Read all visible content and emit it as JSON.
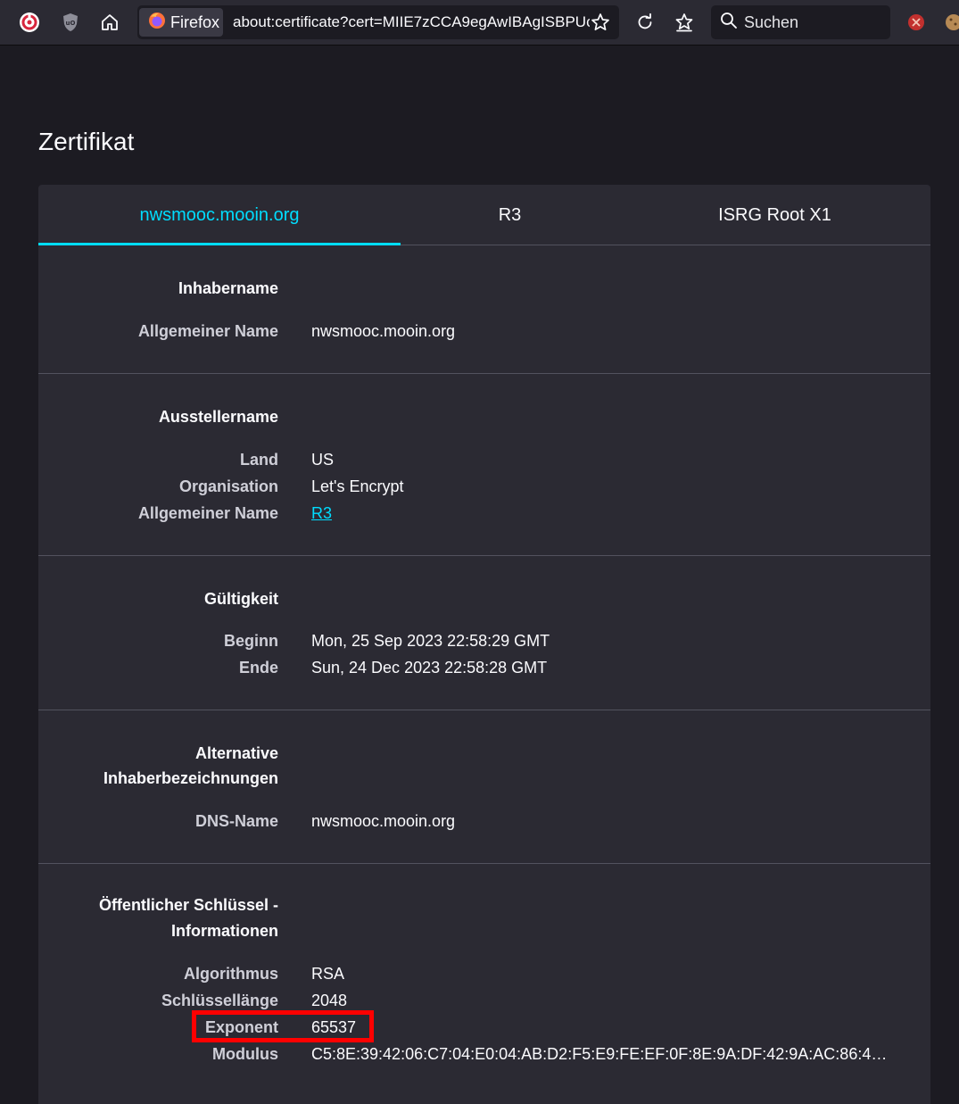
{
  "browser": {
    "identity_label": "Firefox",
    "url": "about:certificate?cert=MIIE7zCCA9egAwIBAgISBPUc",
    "search_placeholder": "Suchen",
    "icons": {
      "app": "spiral-app-icon",
      "ublock": "ublock-origin-icon",
      "home": "home-icon",
      "firefox": "firefox-logo-icon",
      "bookmark": "star-icon",
      "reload": "reload-icon",
      "bookmarks_menu": "bookmark-star-icon",
      "search": "search-icon",
      "ext_red": "red-extension-icon",
      "ext_cookie": "cookie-extension-icon"
    }
  },
  "page": {
    "title": "Zertifikat"
  },
  "tabs": [
    {
      "label": "nwsmooc.mooin.org",
      "selected": true
    },
    {
      "label": "R3",
      "selected": false
    },
    {
      "label": "ISRG Root X1",
      "selected": false
    }
  ],
  "sections": {
    "subject": {
      "title": "Inhabername",
      "rows": [
        {
          "label": "Allgemeiner Name",
          "value": "nwsmooc.mooin.org"
        }
      ]
    },
    "issuer": {
      "title": "Ausstellername",
      "rows": [
        {
          "label": "Land",
          "value": "US"
        },
        {
          "label": "Organisation",
          "value": "Let's Encrypt"
        },
        {
          "label": "Allgemeiner Name",
          "value": "R3"
        }
      ]
    },
    "validity": {
      "title": "Gültigkeit",
      "rows": [
        {
          "label": "Beginn",
          "value": "Mon, 25 Sep 2023 22:58:29 GMT"
        },
        {
          "label": "Ende",
          "value": "Sun, 24 Dec 2023 22:58:28 GMT"
        }
      ]
    },
    "san": {
      "title_line1": "Alternative",
      "title_line2": "Inhaberbezeichnungen",
      "rows": [
        {
          "label": "DNS-Name",
          "value": "nwsmooc.mooin.org"
        }
      ]
    },
    "public_key": {
      "title_line1": "Öffentlicher Schlüssel -",
      "title_line2": "Informationen",
      "rows": [
        {
          "label": "Algorithmus",
          "value": "RSA"
        },
        {
          "label": "Schlüssellänge",
          "value": "2048"
        },
        {
          "label": "Exponent",
          "value": "65537"
        },
        {
          "label": "Modulus",
          "value": "C5:8E:39:42:06:C7:04:E0:04:AB:D2:F5:E9:FE:EF:0F:8E:9A:DF:42:9A:AC:86:4C:11:24..."
        }
      ]
    }
  },
  "colors": {
    "accent": "#00ddff",
    "highlight": "#ff0000",
    "page_bg": "#1c1b22",
    "card_bg": "#2b2a33"
  }
}
